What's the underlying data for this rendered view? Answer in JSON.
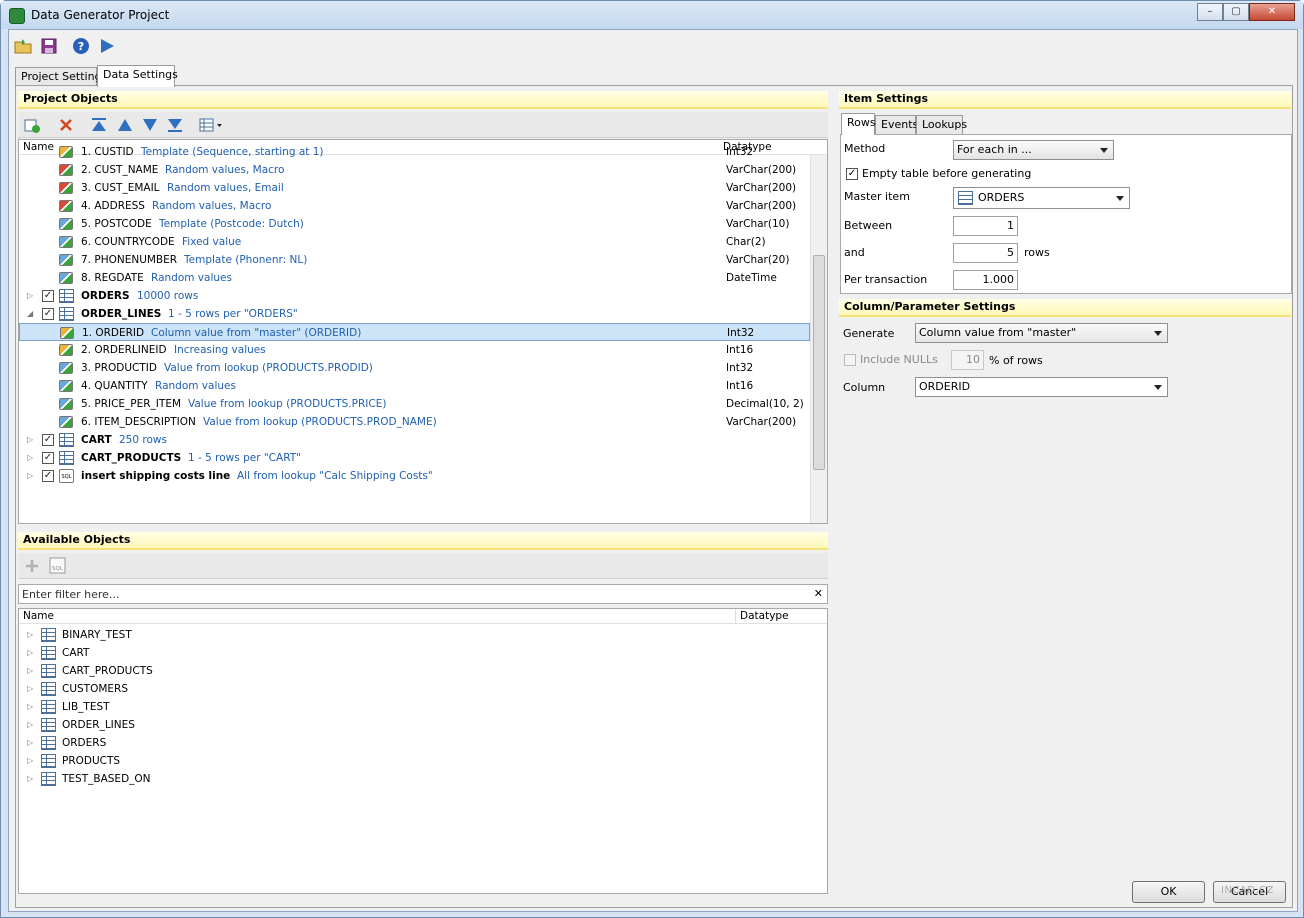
{
  "window": {
    "title": "Data Generator Project",
    "min": "–",
    "max": "▢",
    "close": "✕"
  },
  "toolbar": {
    "icons": [
      "open-project-icon",
      "save-icon",
      "help-icon",
      "run-icon"
    ]
  },
  "tabs": [
    "Project Settings",
    "Data Settings"
  ],
  "project_objects": {
    "title": "Project Objects",
    "col_name": "Name",
    "col_datatype": "Datatype",
    "rows": [
      {
        "name": "1. CUSTID",
        "desc": "Template (Sequence, starting at 1)",
        "dt": "Int32"
      },
      {
        "name": "2. CUST_NAME",
        "desc": "Random values, Macro",
        "dt": "VarChar(200)"
      },
      {
        "name": "3. CUST_EMAIL",
        "desc": "Random values, Email",
        "dt": "VarChar(200)"
      },
      {
        "name": "4. ADDRESS",
        "desc": "Random values, Macro",
        "dt": "VarChar(200)"
      },
      {
        "name": "5. POSTCODE",
        "desc": "Template (Postcode: Dutch)",
        "dt": "VarChar(10)"
      },
      {
        "name": "6. COUNTRYCODE",
        "desc": "Fixed value",
        "dt": "Char(2)"
      },
      {
        "name": "7. PHONENUMBER",
        "desc": "Template (Phonenr: NL)",
        "dt": "VarChar(20)"
      },
      {
        "name": "8. REGDATE",
        "desc": "Random values",
        "dt": "DateTime"
      },
      {
        "name": "ORDERS",
        "desc": "10000 rows",
        "dt": ""
      },
      {
        "name": "ORDER_LINES",
        "desc": "1 - 5 rows per \"ORDERS\"",
        "dt": ""
      },
      {
        "name": "1. ORDERID",
        "desc": "Column value from \"master\" (ORDERID)",
        "dt": "Int32"
      },
      {
        "name": "2. ORDERLINEID",
        "desc": "Increasing values",
        "dt": "Int16"
      },
      {
        "name": "3. PRODUCTID",
        "desc": "Value from lookup (PRODUCTS.PRODID)",
        "dt": "Int32"
      },
      {
        "name": "4. QUANTITY",
        "desc": "Random values",
        "dt": "Int16"
      },
      {
        "name": "5. PRICE_PER_ITEM",
        "desc": "Value from lookup (PRODUCTS.PRICE)",
        "dt": "Decimal(10, 2)"
      },
      {
        "name": "6. ITEM_DESCRIPTION",
        "desc": "Value from lookup (PRODUCTS.PROD_NAME)",
        "dt": "VarChar(200)"
      },
      {
        "name": "CART",
        "desc": "250 rows",
        "dt": ""
      },
      {
        "name": "CART_PRODUCTS",
        "desc": "1 - 5 rows per \"CART\"",
        "dt": ""
      },
      {
        "name": "insert shipping costs line",
        "desc": "All from lookup \"Calc Shipping Costs\"",
        "dt": ""
      }
    ]
  },
  "available_objects": {
    "title": "Available Objects",
    "filter_placeholder": "Enter filter here...",
    "clear": "✕",
    "col_name": "Name",
    "col_datatype": "Datatype",
    "items": [
      "BINARY_TEST",
      "CART",
      "CART_PRODUCTS",
      "CUSTOMERS",
      "LIB_TEST",
      "ORDER_LINES",
      "ORDERS",
      "PRODUCTS",
      "TEST_BASED_ON"
    ]
  },
  "item_settings": {
    "title": "Item Settings",
    "tabs": [
      "Rows",
      "Events",
      "Lookups"
    ],
    "method_label": "Method",
    "method_value": "For each in ...",
    "empty_table_label": "Empty table before generating",
    "master_label": "Master item",
    "master_value": "ORDERS",
    "between_label": "Between",
    "between_value": "1",
    "and_label": "and",
    "and_value": "5",
    "rows_suffix": "rows",
    "per_tx_label": "Per transaction",
    "per_tx_value": "1.000"
  },
  "column_settings": {
    "title": "Column/Parameter Settings",
    "generate_label": "Generate",
    "generate_value": "Column value from \"master\"",
    "nulls_label": "Include NULLs",
    "nulls_value": "10",
    "nulls_suffix": "% of rows",
    "column_label": "Column",
    "column_value": "ORDERID"
  },
  "buttons": {
    "ok": "OK",
    "cancel": "Cancel"
  },
  "watermark": "INCAD.CZ"
}
